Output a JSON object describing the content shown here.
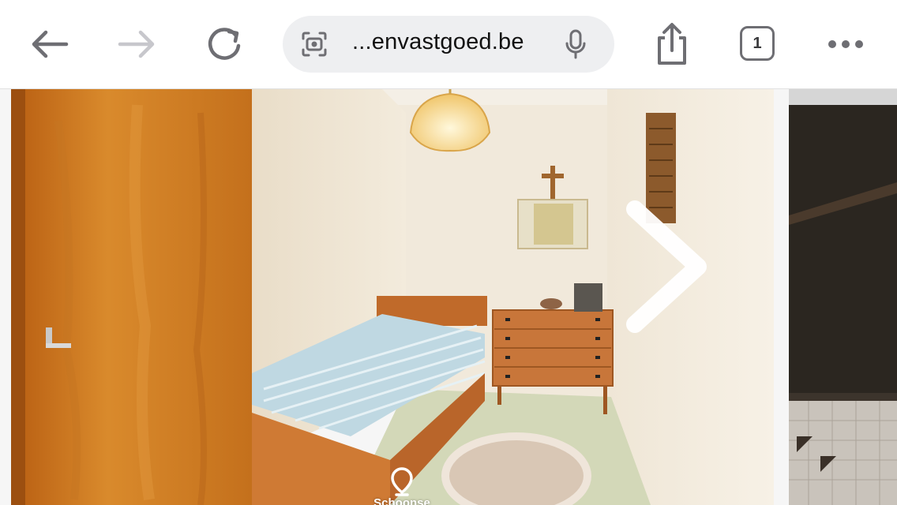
{
  "toolbar": {
    "back_icon": "arrow-left-icon",
    "forward_icon": "arrow-right-icon",
    "reload_icon": "reload-icon",
    "share_icon": "share-icon",
    "more_icon": "ellipsis-icon",
    "tab_count": "1"
  },
  "address_bar": {
    "lens_icon": "visual-search-icon",
    "url": "...envastgoed.be",
    "mic_icon": "microphone-icon"
  },
  "gallery": {
    "current_image": "bedroom photo with single bed, dresser, pendant lamp and wooden wardrobe",
    "next_button_icon": "chevron-right-icon",
    "location_label": "Schoonse"
  },
  "colors": {
    "toolbar_bg": "#ffffff",
    "url_pill_bg": "#eeeff1",
    "icon_gray": "#6e6e73",
    "disabled_gray": "#c7c7cc"
  }
}
